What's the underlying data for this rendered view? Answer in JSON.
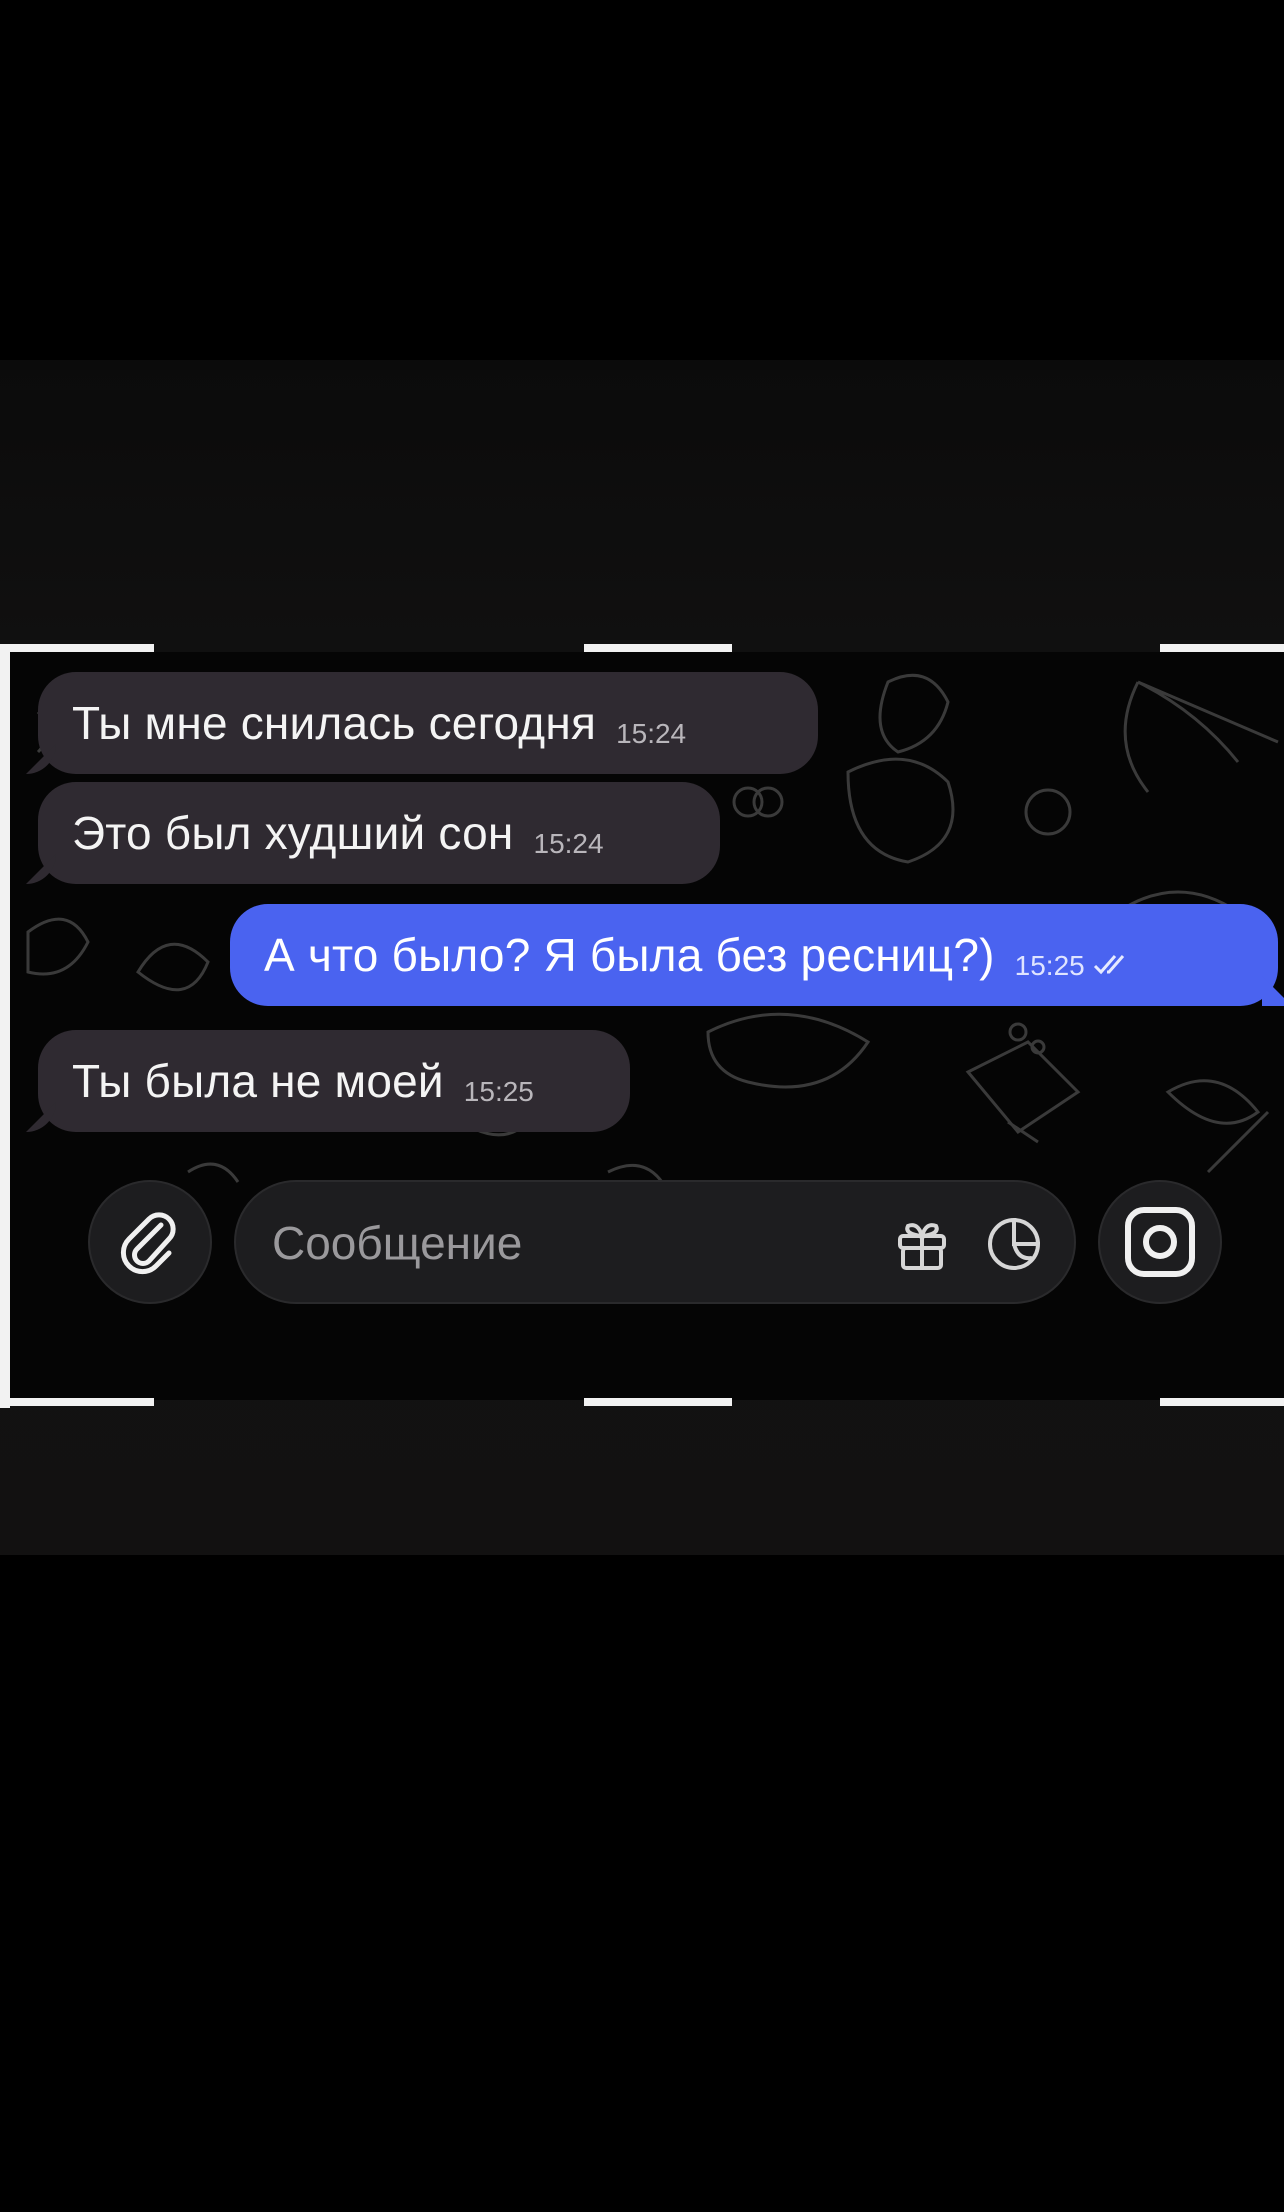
{
  "messages": [
    {
      "text": "Ты мне снилась сегодня",
      "time": "15:24",
      "direction": "incoming"
    },
    {
      "text": "Это был худший сон",
      "time": "15:24",
      "direction": "incoming"
    },
    {
      "text": "А что было? Я была без ресниц?)",
      "time": "15:25",
      "direction": "outgoing",
      "read": true
    },
    {
      "text": "Ты была не моей",
      "time": "15:25",
      "direction": "incoming"
    }
  ],
  "composer": {
    "placeholder": "Сообщение",
    "attach_icon": "paperclip-icon",
    "gift_icon": "gift-icon",
    "sticker_icon": "sticker-icon",
    "camera_icon": "camera-icon"
  },
  "colors": {
    "incoming_bubble": "#2f2a31",
    "outgoing_bubble": "#4a63f0",
    "background": "#000000"
  }
}
